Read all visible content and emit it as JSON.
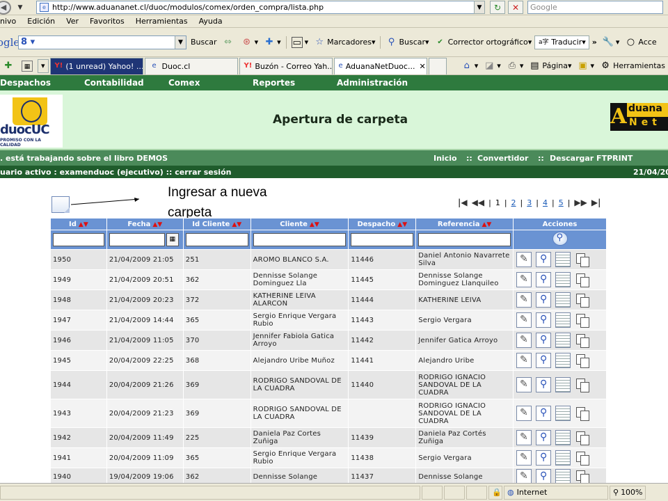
{
  "browser": {
    "url": "http://www.aduananet.cl/duoc/modulos/comex/orden_compra/lista.php",
    "search_placeholder": "Google",
    "menu": [
      "nivo",
      "Edición",
      "Ver",
      "Favoritos",
      "Herramientas",
      "Ayuda"
    ],
    "google_bar": {
      "logo": "ogle",
      "search_label": "Buscar",
      "marcadores": "Marcadores",
      "buscar2": "Buscar",
      "corrector": "Corrector ortográfico",
      "traducir": "Traducir",
      "acce": "Acce"
    },
    "tabs": [
      {
        "label": "(1 unread) Yahoo! ..."
      },
      {
        "label": "Duoc.cl"
      },
      {
        "label": "Buzón - Correo Yah..."
      },
      {
        "label": "AduanaNetDuoc..."
      }
    ],
    "toolbar_right": {
      "pagina": "Página",
      "herramientas": "Herramientas"
    }
  },
  "app": {
    "nav": [
      "Despachos",
      "Contabilidad",
      "Comex",
      "Reportes",
      "Administración"
    ],
    "title": "Apertura de carpeta",
    "logo_left_word": "duocUC",
    "logo_left_tag": "PROMISO CON LA CALIDAD",
    "logo_right_top": "duana",
    "logo_right_bottom": "Net",
    "logo_right_a": "A",
    "status_book": ". está trabajando sobre el libro DEMOS",
    "links": {
      "inicio": "Inicio",
      "sep": "::",
      "convertidor": "Convertidor",
      "descargar": "Descargar FTPRINT"
    },
    "user_line": "uario activo : examenduoc  (ejecutivo) :: cerrar sesión",
    "date": "21/04/2009"
  },
  "annotation": {
    "text": "Ingresar a nueva carpeta"
  },
  "pager": {
    "pages": [
      "1",
      "2",
      "3",
      "4",
      "5"
    ]
  },
  "table": {
    "headers": [
      "Id",
      "Fecha",
      "Id Cliente",
      "Cliente",
      "Despacho",
      "Referencia",
      "Acciones"
    ],
    "rows": [
      {
        "id": "1950",
        "fecha": "21/04/2009 21:05",
        "id_cliente": "251",
        "cliente": "AROMO BLANCO S.A.",
        "despacho": "11446",
        "referencia": "Daniel Antonio Navarrete Silva"
      },
      {
        "id": "1949",
        "fecha": "21/04/2009 20:51",
        "id_cliente": "362",
        "cliente": "Dennisse Solange Dominguez Lla",
        "despacho": "11445",
        "referencia": "Dennisse Solange Dominguez Llanquileo"
      },
      {
        "id": "1948",
        "fecha": "21/04/2009 20:23",
        "id_cliente": "372",
        "cliente": "KATHERINE LEIVA ALARCON",
        "despacho": "11444",
        "referencia": "KATHERINE LEIVA"
      },
      {
        "id": "1947",
        "fecha": "21/04/2009 14:44",
        "id_cliente": "365",
        "cliente": "Sergio Enrique Vergara Rubio",
        "despacho": "11443",
        "referencia": "Sergio Vergara"
      },
      {
        "id": "1946",
        "fecha": "21/04/2009 11:05",
        "id_cliente": "370",
        "cliente": "Jennifer Fabiola Gatica Arroyo",
        "despacho": "11442",
        "referencia": "Jennifer Gatica Arroyo"
      },
      {
        "id": "1945",
        "fecha": "20/04/2009 22:25",
        "id_cliente": "368",
        "cliente": "Alejandro Uribe Muñoz",
        "despacho": "11441",
        "referencia": "Alejandro Uribe"
      },
      {
        "id": "1944",
        "fecha": "20/04/2009 21:26",
        "id_cliente": "369",
        "cliente": "RODRIGO SANDOVAL DE LA CUADRA",
        "despacho": "11440",
        "referencia": "RODRIGO IGNACIO SANDOVAL DE LA CUADRA"
      },
      {
        "id": "1943",
        "fecha": "20/04/2009 21:23",
        "id_cliente": "369",
        "cliente": "RODRIGO SANDOVAL DE LA CUADRA",
        "despacho": "",
        "referencia": "RODRIGO IGNACIO SANDOVAL DE LA CUADRA"
      },
      {
        "id": "1942",
        "fecha": "20/04/2009 11:49",
        "id_cliente": "225",
        "cliente": "Daniela Paz Cortes Zuñiga",
        "despacho": "11439",
        "referencia": "Daniela Paz Cortés Zuñiga"
      },
      {
        "id": "1941",
        "fecha": "20/04/2009 11:09",
        "id_cliente": "365",
        "cliente": "Sergio Enrique Vergara Rubio",
        "despacho": "11438",
        "referencia": "Sergio Vergara"
      },
      {
        "id": "1940",
        "fecha": "19/04/2009 19:06",
        "id_cliente": "362",
        "cliente": "Dennisse Solange",
        "despacho": "11437",
        "referencia": "Dennisse Solange"
      }
    ]
  },
  "statusbar": {
    "zone": "Internet",
    "zoom": "100%"
  }
}
